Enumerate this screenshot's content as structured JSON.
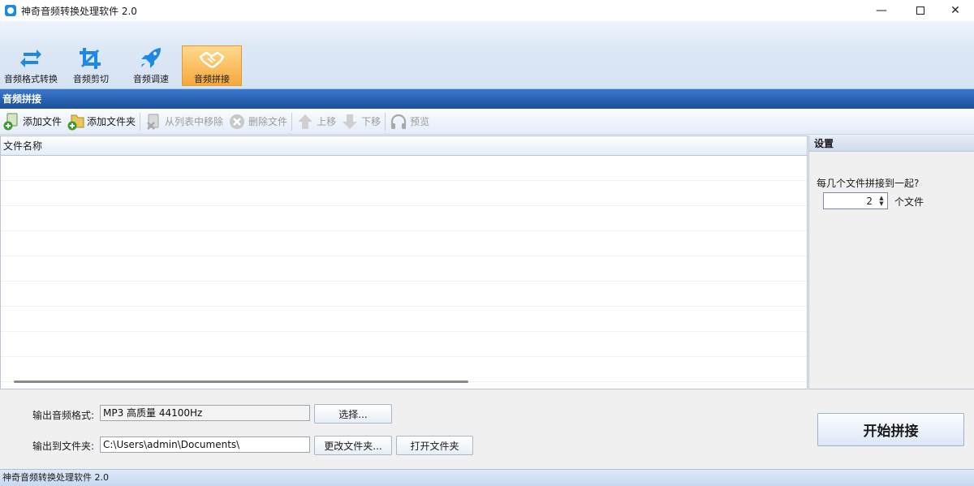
{
  "window": {
    "title": "神奇音频转换处理软件 2.0",
    "minimize": "—",
    "close": "✕"
  },
  "ribbon": {
    "items": [
      {
        "label": "音频格式转换",
        "icon": "convert-arrows-icon"
      },
      {
        "label": "音频剪切",
        "icon": "crop-icon"
      },
      {
        "label": "音频调速",
        "icon": "rocket-icon"
      },
      {
        "label": "音频拼接",
        "icon": "handshake-icon",
        "active": true
      }
    ]
  },
  "section": {
    "title": "音频拼接"
  },
  "toolbar": {
    "add_file": "添加文件",
    "add_folder": "添加文件夹",
    "remove_from_list": "从列表中移除",
    "delete_file": "删除文件",
    "move_up": "上移",
    "move_down": "下移",
    "preview": "预览"
  },
  "file_list": {
    "column_header": "文件名称",
    "rows": []
  },
  "settings": {
    "title": "设置",
    "question": "每几个文件拼接到一起?",
    "count": "2",
    "unit": "个文件"
  },
  "output": {
    "format_label": "输出音频格式:",
    "format_value": "MP3 高质量 44100Hz",
    "select_button": "选择...",
    "folder_label": "输出到文件夹:",
    "folder_value": "C:\\Users\\admin\\Documents\\",
    "change_folder_button": "更改文件夹...",
    "open_folder_button": "打开文件夹",
    "start_button": "开始拼接"
  },
  "statusbar": {
    "text": "神奇音频转换处理软件 2.0"
  },
  "colors": {
    "accent": "#1c4f9c",
    "active_tab": "#f6a93b",
    "icon_blue": "#1e88e5"
  }
}
